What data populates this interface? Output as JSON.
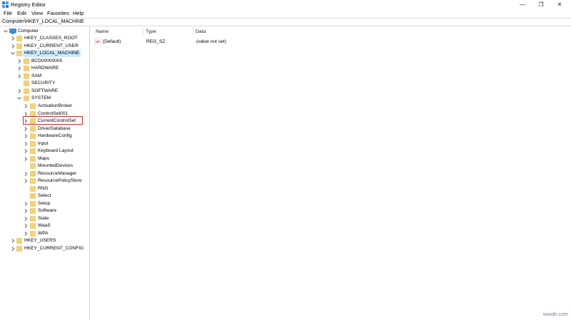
{
  "window": {
    "title": "Registry Editor",
    "controls": {
      "minimize": "—",
      "maximize": "❐",
      "close": "✕"
    }
  },
  "menu": [
    "File",
    "Edit",
    "View",
    "Favorites",
    "Help"
  ],
  "address": "Computer\\HKEY_LOCAL_MACHINE",
  "tree": {
    "root": "Computer",
    "hives": {
      "classes_root": "HKEY_CLASSES_ROOT",
      "current_user": "HKEY_CURRENT_USER",
      "local_machine": "HKEY_LOCAL_MACHINE",
      "users": "HKEY_USERS",
      "current_config": "HKEY_CURRENT_CONFIG"
    },
    "hklm_children": [
      "BCD00000000",
      "HARDWARE",
      "SAM",
      "SECURITY",
      "SOFTWARE",
      "SYSTEM"
    ],
    "system_children": [
      "ActivationBroker",
      "ControlSet001",
      "CurrentControlSet",
      "DriverDatabase",
      "HardwareConfig",
      "Input",
      "Keyboard Layout",
      "Maps",
      "MountedDevices",
      "ResourceManager",
      "ResourcePolicyStore",
      "RNG",
      "Select",
      "Setup",
      "Software",
      "State",
      "WaaS",
      "WPA"
    ]
  },
  "columns": {
    "name": "Name",
    "type": "Type",
    "data": "Data"
  },
  "values": [
    {
      "name": "(Default)",
      "type": "REG_SZ",
      "data": "(value not set)"
    }
  ],
  "watermark": "wsxdn.com",
  "colors": {
    "folder": "#f2d27a",
    "selection": "#cce8ff",
    "highlight": "#d42b2b"
  }
}
